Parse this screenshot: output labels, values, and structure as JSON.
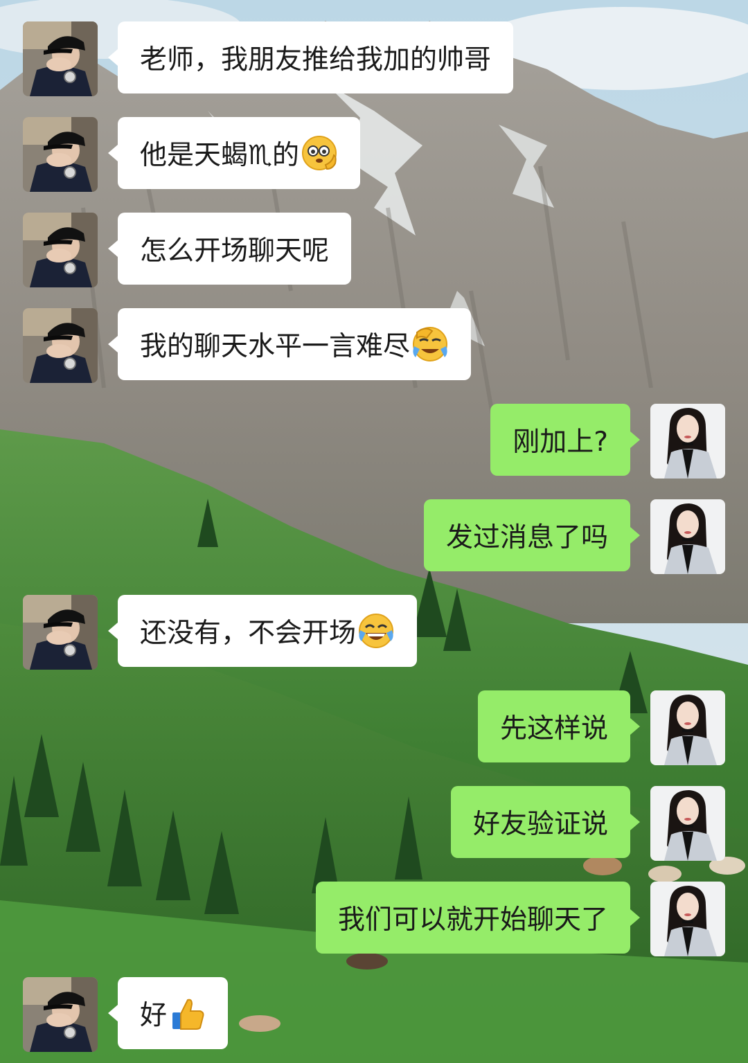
{
  "chat": {
    "messages": [
      {
        "side": "in",
        "text": "老师，我朋友推给我加的帅哥",
        "emoji": ""
      },
      {
        "side": "in",
        "text": "他是天蝎♏的",
        "emoji": "pleading-hand-face"
      },
      {
        "side": "in",
        "text": "怎么开场聊天呢",
        "emoji": ""
      },
      {
        "side": "in",
        "text": "我的聊天水平一言难尽",
        "emoji": "facepalm-cry-face"
      },
      {
        "side": "out",
        "text": "刚加上?",
        "emoji": ""
      },
      {
        "side": "out",
        "text": "发过消息了吗",
        "emoji": ""
      },
      {
        "side": "in",
        "text": "还没有，不会开场",
        "emoji": "tears-of-joy-face"
      },
      {
        "side": "out",
        "text": "先这样说",
        "emoji": ""
      },
      {
        "side": "out",
        "text": "好友验证说",
        "emoji": ""
      },
      {
        "side": "out",
        "text": "我们可以就开始聊天了",
        "emoji": ""
      },
      {
        "side": "in",
        "text": "好",
        "emoji": "thumbs-up"
      }
    ]
  },
  "colors": {
    "incoming_bubble": "#ffffff",
    "outgoing_bubble": "#95ec69",
    "text": "#1a1a1a"
  },
  "avatars": {
    "incoming": "man-in-black-cap-avatar",
    "outgoing": "woman-long-dark-hair-avatar"
  }
}
